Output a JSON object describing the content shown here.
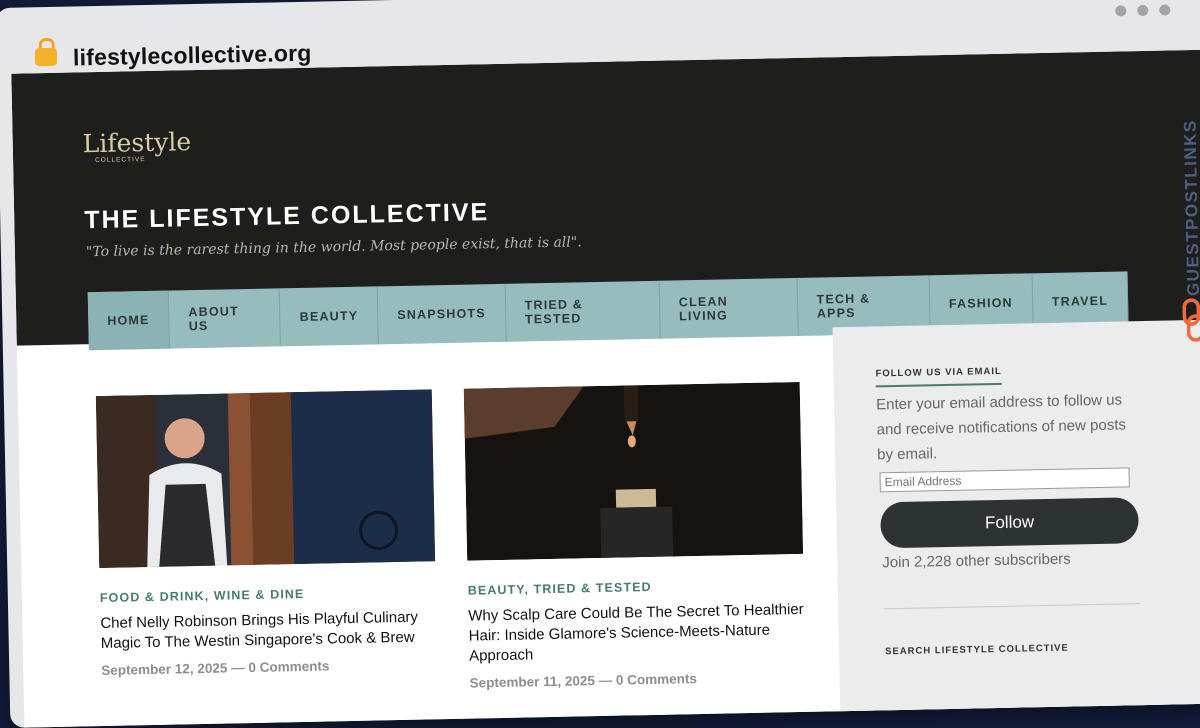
{
  "browser": {
    "url": "lifestylecollective.org"
  },
  "site": {
    "title": "THE LIFESTYLE COLLECTIVE",
    "tagline": "\"To live is the rarest thing in the world. Most people exist, that is all\".",
    "logo_text": "Lifestyle",
    "logo_subtext": "COLLECTIVE"
  },
  "nav": [
    "HOME",
    "ABOUT US",
    "BEAUTY",
    "SNAPSHOTS",
    "TRIED & TESTED",
    "CLEAN LIVING",
    "TECH & APPS",
    "FASHION",
    "TRAVEL"
  ],
  "posts": [
    {
      "categories": "FOOD & DRINK, WINE & DINE",
      "title": "Chef Nelly Robinson Brings His Playful Culinary Magic To The Westin Singapore's Cook & Brew",
      "meta": "September 12, 2025 — 0 Comments"
    },
    {
      "categories": "BEAUTY, TRIED & TESTED",
      "title": "Why Scalp Care Could Be The Secret To Healthier Hair: Inside Glamore's Science-Meets-Nature Approach",
      "meta": "September 11, 2025 — 0 Comments"
    }
  ],
  "sidebar": {
    "heading": "FOLLOW US VIA EMAIL",
    "text": "Enter your email address to follow us and receive notifications of new posts by email.",
    "email_placeholder": "Email Address",
    "button": "Follow",
    "subscribers": "Join 2,228 other subscribers",
    "footer_heading": "SEARCH LIFESTYLE COLLECTIVE"
  },
  "badge": {
    "text": "GUESTPOSTLINKS",
    "icon": "link-icon"
  },
  "colors": {
    "header_bg": "#1e1e1d",
    "nav_bg": "#96bcbe",
    "accent": "#477a70",
    "button_bg": "#2d3234",
    "badge_icon": "#f06a3c"
  }
}
